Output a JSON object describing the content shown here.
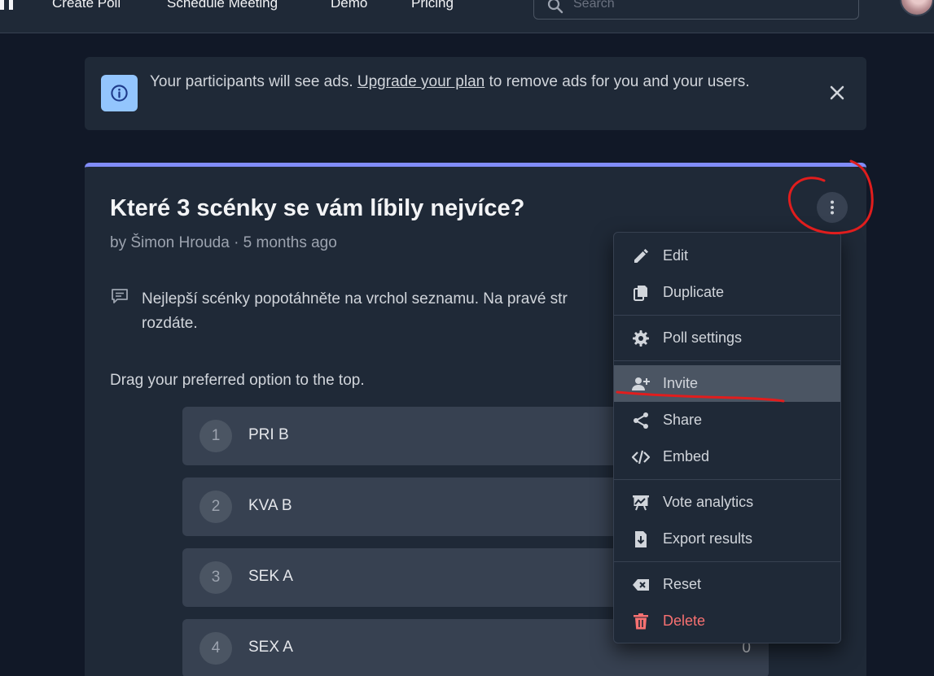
{
  "nav": {
    "links": [
      "Create Poll",
      "Schedule Meeting",
      "Demo",
      "Pricing"
    ],
    "search_placeholder": "Search"
  },
  "banner": {
    "text_before": "Your participants will see ads.",
    "link_text": "Upgrade your plan",
    "text_after": "to remove ads for you and your users.",
    "icon": "info-icon",
    "close_icon": "close-icon"
  },
  "poll": {
    "title": "Které 3 scénky se vám líbily nejvíce?",
    "meta": "by Šimon Hrouda · 5 months ago",
    "description": "Nejlepší scénky popotáhněte na vrchol seznamu. Na pravé str",
    "description_line2": "rozdáte.",
    "instruction": "Drag your preferred option to the top.",
    "accent_color": "#818cf8",
    "options": [
      {
        "num": "1",
        "label": "PRI B",
        "score": ""
      },
      {
        "num": "2",
        "label": "KVA B",
        "score": ""
      },
      {
        "num": "3",
        "label": "SEK A",
        "score": ""
      },
      {
        "num": "4",
        "label": "SEX A",
        "score": "0"
      }
    ]
  },
  "menu": {
    "items": [
      {
        "label": "Edit",
        "icon": "pencil-icon"
      },
      {
        "label": "Duplicate",
        "icon": "copy-icon"
      },
      {
        "label": "Poll settings",
        "icon": "gear-icon"
      },
      {
        "label": "Invite",
        "icon": "user-plus-icon"
      },
      {
        "label": "Share",
        "icon": "share-icon"
      },
      {
        "label": "Embed",
        "icon": "code-icon"
      },
      {
        "label": "Vote analytics",
        "icon": "analytics-icon"
      },
      {
        "label": "Export results",
        "icon": "export-icon"
      },
      {
        "label": "Reset",
        "icon": "backspace-icon"
      },
      {
        "label": "Delete",
        "icon": "trash-icon"
      }
    ],
    "danger_color": "#f87171"
  }
}
